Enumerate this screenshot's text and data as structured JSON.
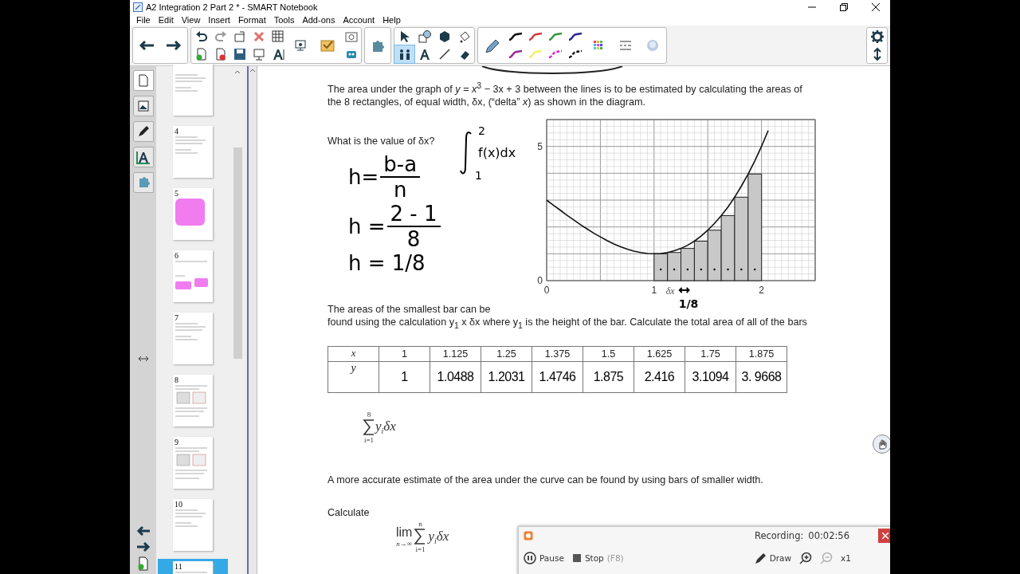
{
  "window": {
    "title": "A2 Integration 2 Part 2 * - SMART Notebook"
  },
  "menu": [
    "File",
    "Edit",
    "View",
    "Insert",
    "Format",
    "Tools",
    "Add-ons",
    "Account",
    "Help"
  ],
  "toolbar": {
    "tools": [
      {
        "kind": "select",
        "selected": false
      },
      {
        "kind": "shapes",
        "selected": false
      },
      {
        "kind": "regular-shapes",
        "selected": false
      },
      {
        "kind": "fill",
        "selected": false
      },
      {
        "kind": "people",
        "selected": true
      },
      {
        "kind": "text",
        "selected": false
      },
      {
        "kind": "line",
        "selected": false
      },
      {
        "kind": "eraser",
        "selected": false
      }
    ],
    "pens": [
      {
        "kind": "solid",
        "color": "#111111"
      },
      {
        "kind": "solid",
        "color": "#d04040"
      },
      {
        "kind": "solid",
        "color": "#3a9a3a"
      },
      {
        "kind": "solid",
        "color": "#2a2a9a"
      },
      {
        "kind": "solid",
        "color": "#9a2a9a"
      },
      {
        "kind": "solid",
        "color": "#f0f070"
      },
      {
        "kind": "dashed",
        "color": "#e020d0"
      },
      {
        "kind": "dashed",
        "color": "#111111"
      }
    ]
  },
  "sidebar": {
    "tabs": [
      {
        "kind": "page-sorter",
        "selected": true
      },
      {
        "kind": "gallery",
        "selected": false
      },
      {
        "kind": "pen",
        "selected": false
      },
      {
        "kind": "properties",
        "selected": false
      },
      {
        "kind": "add-ons",
        "selected": false
      }
    ],
    "thumbnails": [
      {
        "kind": "text",
        "selected": false
      },
      {
        "number": "4",
        "kind": "text",
        "selected": false
      },
      {
        "number": "5",
        "kind": "pink-block",
        "selected": false
      },
      {
        "number": "6",
        "kind": "pink-pair",
        "selected": false
      },
      {
        "number": "7",
        "kind": "text",
        "selected": false
      },
      {
        "number": "8",
        "kind": "graph",
        "selected": false
      },
      {
        "number": "9",
        "kind": "graph",
        "selected": false
      },
      {
        "number": "10",
        "kind": "text",
        "selected": false
      },
      {
        "number": "11",
        "kind": "graph",
        "selected": true
      }
    ]
  },
  "page": {
    "intro": "The area under the graph of *y* = *x*$^{3}$ − 3x + 3 between the lines is to be estimated by calculating the areas of the 8 rectangles, of equal width, δx, (“delta” *x*) as shown in the diagram.",
    "question": "What is the value of δx?",
    "working": [
      {
        "kind": "fraction",
        "left": "h=",
        "numerator": "b-a",
        "denominator": "n"
      },
      {
        "kind": "fraction",
        "left": "h =",
        "numerator": "2 - 1",
        "denominator": "8"
      },
      {
        "kind": "plain",
        "text": "h = 1/8"
      }
    ],
    "integral": {
      "upper": "2",
      "lower": "1",
      "integrand": "f(x)dx"
    },
    "chart_data": {
      "type": "bar",
      "x": [
        0,
        0.0625,
        0.125,
        0.1875,
        0.25,
        0.3125,
        0.375,
        0.4375,
        0.5,
        0.5625,
        0.625,
        0.6875,
        0.75,
        0.8125,
        0.875,
        0.9375,
        1,
        1.0625,
        1.125,
        1.1875,
        1.25,
        1.3125,
        1.375,
        1.4375,
        1.5,
        1.5625,
        1.625,
        1.6875,
        1.75,
        1.8125,
        1.875,
        1.9375,
        2,
        2.0625
      ],
      "series": [
        {
          "type": "line",
          "color": "#111111",
          "values": [
            3,
            2.81,
            2.63,
            2.44,
            2.27,
            2.09,
            1.93,
            1.77,
            1.63,
            1.49,
            1.37,
            1.26,
            1.17,
            1.1,
            1.05,
            1.01,
            1,
            1.01,
            1.05,
            1.11,
            1.2,
            1.32,
            1.47,
            1.66,
            1.88,
            2.13,
            2.42,
            2.74,
            3.11,
            3.52,
            3.97,
            4.46,
            5,
            5.59
          ]
        },
        {
          "color": "#c8c8c8",
          "values": [
            null,
            null,
            null,
            null,
            null,
            null,
            null,
            null,
            null,
            null,
            null,
            null,
            null,
            null,
            null,
            null,
            null,
            1,
            null,
            1.05,
            null,
            1.2,
            null,
            1.47,
            null,
            1.88,
            null,
            2.42,
            null,
            3.11,
            null,
            3.97,
            null,
            null
          ]
        }
      ],
      "grid": true,
      "xlim": [
        0,
        2.5
      ],
      "ylim": [
        0,
        6
      ],
      "xticks": [
        {
          "value": 0,
          "label": "0"
        },
        {
          "value": 1,
          "label": "1"
        },
        {
          "value": 2,
          "label": "2"
        }
      ],
      "yticks": [
        {
          "value": 0,
          "label": "0"
        },
        {
          "value": 5,
          "label": "5"
        }
      ]
    },
    "graph_notes": {
      "delta_label": "δx",
      "handwritten": "1/8"
    },
    "bars_intro": "The areas of the smallest bar can be",
    "bars_text": "found using the calculation y$_{1}$ x δx where y$_{1}$ is the height of the bar. Calculate the total area of all of the bars",
    "table": {
      "rows": [
        {
          "label": "x",
          "cells": [
            {
              "kind": "printed",
              "text": "1"
            },
            {
              "kind": "printed",
              "text": "1.125"
            },
            {
              "kind": "printed",
              "text": "1.25"
            },
            {
              "kind": "printed",
              "text": "1.375"
            },
            {
              "kind": "printed",
              "text": "1.5"
            },
            {
              "kind": "printed",
              "text": "1.625"
            },
            {
              "kind": "printed",
              "text": "1.75"
            },
            {
              "kind": "printed",
              "text": "1.875"
            }
          ]
        },
        {
          "label": "y",
          "cells": [
            {
              "kind": "handwritten",
              "text": "1"
            },
            {
              "kind": "handwritten",
              "text": "1.0488"
            },
            {
              "kind": "handwritten",
              "text": "1.2031"
            },
            {
              "kind": "handwritten",
              "text": "1.4746"
            },
            {
              "kind": "handwritten",
              "text": "1.875"
            },
            {
              "kind": "handwritten",
              "text": "2.416"
            },
            {
              "kind": "handwritten",
              "text": "3.1094"
            },
            {
              "kind": "handwritten",
              "text": "3. 9668"
            }
          ]
        }
      ]
    },
    "sum": {
      "upper": "8",
      "lower": "i=1",
      "body": "*y*$_{i}$*δx*"
    },
    "more_accurate": "A more accurate estimate of the area under the curve can be found by using bars of smaller width.",
    "calculate": "Calculate",
    "limit": {
      "lim": "lim",
      "under": "n→∞",
      "upper": "n",
      "lower": "i=1",
      "body": "*y*$_{i}$*δx*"
    }
  },
  "recorder": {
    "label": "Recording:",
    "time": "00:02:56",
    "controls": [
      {
        "kind": "pause",
        "label": "Pause",
        "disabled": false
      },
      {
        "kind": "stop",
        "label": "Stop",
        "shortcut": "(F8)",
        "disabled": false
      },
      {
        "kind": "draw",
        "label": "Draw",
        "disabled": false
      },
      {
        "kind": "zoom-in",
        "disabled": false
      },
      {
        "kind": "zoom-out",
        "disabled": true
      },
      {
        "kind": "zoom-level",
        "label": "x1",
        "disabled": false
      }
    ]
  }
}
